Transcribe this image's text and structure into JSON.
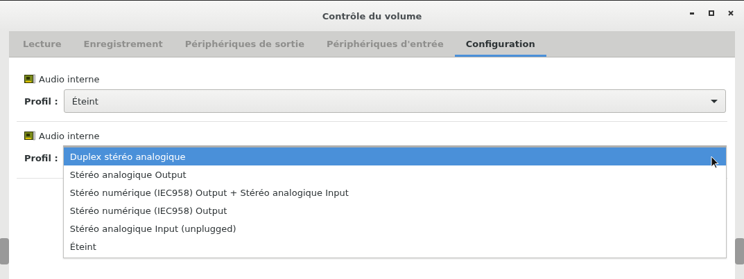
{
  "window": {
    "title": "Contrôle du volume"
  },
  "tabs": [
    {
      "label": "Lecture",
      "selected": false
    },
    {
      "label": "Enregistrement",
      "selected": false
    },
    {
      "label": "Périphériques de sortie",
      "selected": false
    },
    {
      "label": "Périphériques d'entrée",
      "selected": false
    },
    {
      "label": "Configuration",
      "selected": true
    }
  ],
  "cards": [
    {
      "kind": "combo",
      "name": "Audio interne",
      "profile_label": "Profil :",
      "value": "Éteint"
    },
    {
      "kind": "open_menu",
      "name": "Audio interne",
      "profile_label": "Profil :",
      "options": [
        {
          "label": "Duplex stéréo analogique",
          "selected": true
        },
        {
          "label": "Stéréo analogique Output",
          "selected": false
        },
        {
          "label": "Stéréo numérique (IEC958) Output + Stéréo analogique Input",
          "selected": false
        },
        {
          "label": "Stéréo numérique (IEC958) Output",
          "selected": false
        },
        {
          "label": "Stéréo analogique Input (unplugged)",
          "selected": false
        },
        {
          "label": "Éteint",
          "selected": false
        }
      ]
    }
  ]
}
